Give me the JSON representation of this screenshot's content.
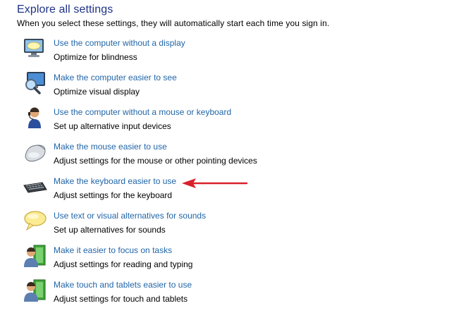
{
  "header": {
    "title": "Explore all settings",
    "subtitle": "When you select these settings, they will automatically start each time you sign in."
  },
  "items": [
    {
      "link": "Use the computer without a display",
      "desc": "Optimize for blindness",
      "icon": "monitor-speech-icon"
    },
    {
      "link": "Make the computer easier to see",
      "desc": "Optimize visual display",
      "icon": "monitor-magnifier-icon"
    },
    {
      "link": "Use the computer without a mouse or keyboard",
      "desc": "Set up alternative input devices",
      "icon": "user-headset-icon"
    },
    {
      "link": "Make the mouse easier to use",
      "desc": "Adjust settings for the mouse or other pointing devices",
      "icon": "mouse-icon"
    },
    {
      "link": "Make the keyboard easier to use",
      "desc": "Adjust settings for the keyboard",
      "icon": "keyboard-icon"
    },
    {
      "link": "Use text or visual alternatives for sounds",
      "desc": "Set up alternatives for sounds",
      "icon": "speech-bubble-icon"
    },
    {
      "link": "Make it easier to focus on tasks",
      "desc": "Adjust settings for reading and typing",
      "icon": "user-document-icon"
    },
    {
      "link": "Make touch and tablets easier to use",
      "desc": "Adjust settings for touch and tablets",
      "icon": "user-tablet-icon"
    }
  ],
  "colors": {
    "link": "#2166a8",
    "title": "#1e3287",
    "arrow": "#d9202a"
  }
}
